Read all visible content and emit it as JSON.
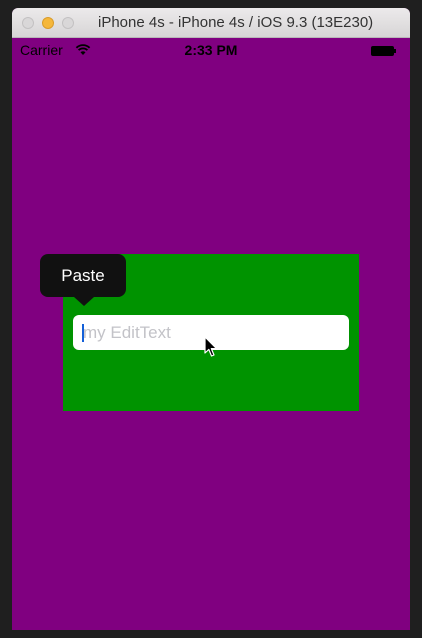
{
  "window": {
    "title": "iPhone 4s - iPhone 4s / iOS 9.3 (13E230)"
  },
  "status_bar": {
    "carrier": "Carrier",
    "time": "2:33 PM",
    "icons": [
      "wifi-icon",
      "battery-icon"
    ]
  },
  "edit_text": {
    "placeholder": "my EditText",
    "value": ""
  },
  "context_menu": {
    "paste_label": "Paste"
  },
  "colors": {
    "background": "#800080",
    "container": "#009300",
    "caret": "#1460d8"
  }
}
